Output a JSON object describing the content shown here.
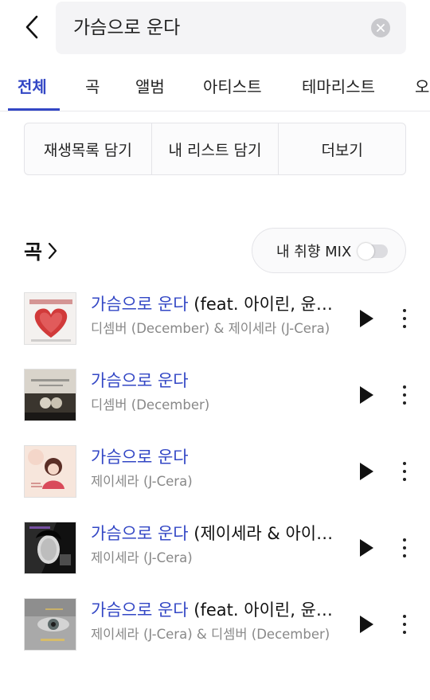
{
  "search": {
    "query": "가슴으로 운다",
    "back_icon": "chevron-left-icon",
    "clear_icon": "clear-icon"
  },
  "tabs": [
    {
      "label": "전체",
      "active": true
    },
    {
      "label": "곡",
      "active": false
    },
    {
      "label": "앨범",
      "active": false
    },
    {
      "label": "아티스트",
      "active": false
    },
    {
      "label": "테마리스트",
      "active": false
    },
    {
      "label": "오",
      "active": false
    }
  ],
  "actions": {
    "add_to_playlist": "재생목록 담기",
    "add_to_my_list": "내 리스트 담기",
    "more": "더보기"
  },
  "songs_section": {
    "title": "곡",
    "mix_label": "내 취향 MIX",
    "mix_enabled": false
  },
  "songs": [
    {
      "title_match": "가슴으로 운다",
      "title_rest": " (feat. 아이린, 윤…",
      "artist": "디셈버 (December) & 제이세라 (J-Cera)"
    },
    {
      "title_match": "가슴으로 운다",
      "title_rest": "",
      "artist": "디셈버 (December)"
    },
    {
      "title_match": "가슴으로 운다",
      "title_rest": "",
      "artist": "제이세라 (J-Cera)"
    },
    {
      "title_match": "가슴으로 운다",
      "title_rest": " (제이세라 & 아이…",
      "artist": "제이세라 (J-Cera)"
    },
    {
      "title_match": "가슴으로 운다",
      "title_rest": " (feat. 아이린, 윤…",
      "artist": "제이세라 (J-Cera) & 디셈버 (December)"
    }
  ],
  "colors": {
    "accent": "#3347c5",
    "secondary_text": "#888888"
  }
}
